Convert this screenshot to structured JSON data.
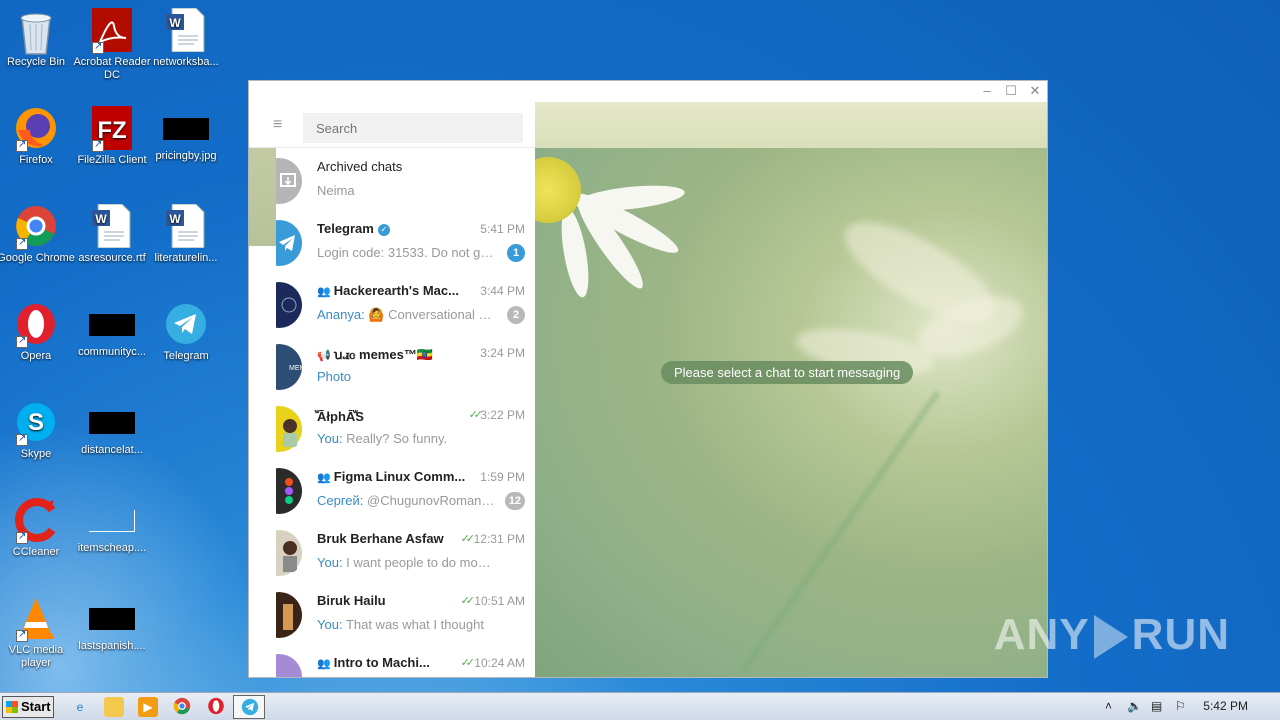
{
  "desktop": {
    "icons": [
      {
        "label": "Recycle Bin"
      },
      {
        "label": "Acrobat Reader DC"
      },
      {
        "label": "networksba..."
      },
      {
        "label": "Firefox"
      },
      {
        "label": "FileZilla Client"
      },
      {
        "label": "pricingby.jpg"
      },
      {
        "label": "Google Chrome"
      },
      {
        "label": "asresource.rtf"
      },
      {
        "label": "literaturelin..."
      },
      {
        "label": "Opera"
      },
      {
        "label": "communityc..."
      },
      {
        "label": "Telegram"
      },
      {
        "label": "Skype"
      },
      {
        "label": "distancelat..."
      },
      {
        "label": "CCleaner"
      },
      {
        "label": "itemscheap...."
      },
      {
        "label": "VLC media player"
      },
      {
        "label": "lastspanish...."
      }
    ]
  },
  "window": {
    "controls": {
      "minimize": "–",
      "maximize": "☐",
      "close": "✕"
    }
  },
  "sidebar": {
    "menu_icon": "≡",
    "search_placeholder": "Search",
    "chats": [
      {
        "title": "Archived chats",
        "message": "Neima",
        "time": "",
        "badge": "",
        "sender": ""
      },
      {
        "title": "Telegram",
        "message": "Login code: 31533. Do not giv...",
        "time": "5:41 PM",
        "badge": "1",
        "sender": ""
      },
      {
        "title": "Hackerearth's Mac...",
        "message": "🙆 Conversational a...",
        "time": "3:44 PM",
        "badge": "2",
        "sender": "Ananya: "
      },
      {
        "title": "ꭒꮧꮳ memes™🇪🇹",
        "message": "Photo",
        "time": "3:24 PM",
        "badge": "",
        "sender": ""
      },
      {
        "title": "ꙻĀłphĀꙻS",
        "message": "Really? So funny.",
        "time": "3:22 PM",
        "badge": "",
        "sender": "You: "
      },
      {
        "title": "Figma Linux Comm...",
        "message": "@ChugunovRoman ...",
        "time": "1:59 PM",
        "badge": "12",
        "sender": "Сергей: "
      },
      {
        "title": "Bruk Berhane Asfaw",
        "message": "I want people to do more re...",
        "time": "12:31 PM",
        "badge": "",
        "sender": "You: "
      },
      {
        "title": "Biruk Hailu",
        "message": "That was what I thought",
        "time": "10:51 AM",
        "badge": "",
        "sender": "You: "
      },
      {
        "title": "Intro to Machi...",
        "message": "",
        "time": "10:24 AM",
        "badge": "",
        "sender": ""
      }
    ]
  },
  "main": {
    "empty_state": "Please select a chat to start messaging"
  },
  "watermark": {
    "left": "ANY",
    "right": "RUN"
  },
  "taskbar": {
    "start_label": "Start",
    "clock": "5:42 PM"
  },
  "colors": {
    "accent": "#3a9bd9",
    "link": "#3a8bc5",
    "read_ticks": "#4fae4e",
    "badge_muted": "#b9b9b9"
  }
}
